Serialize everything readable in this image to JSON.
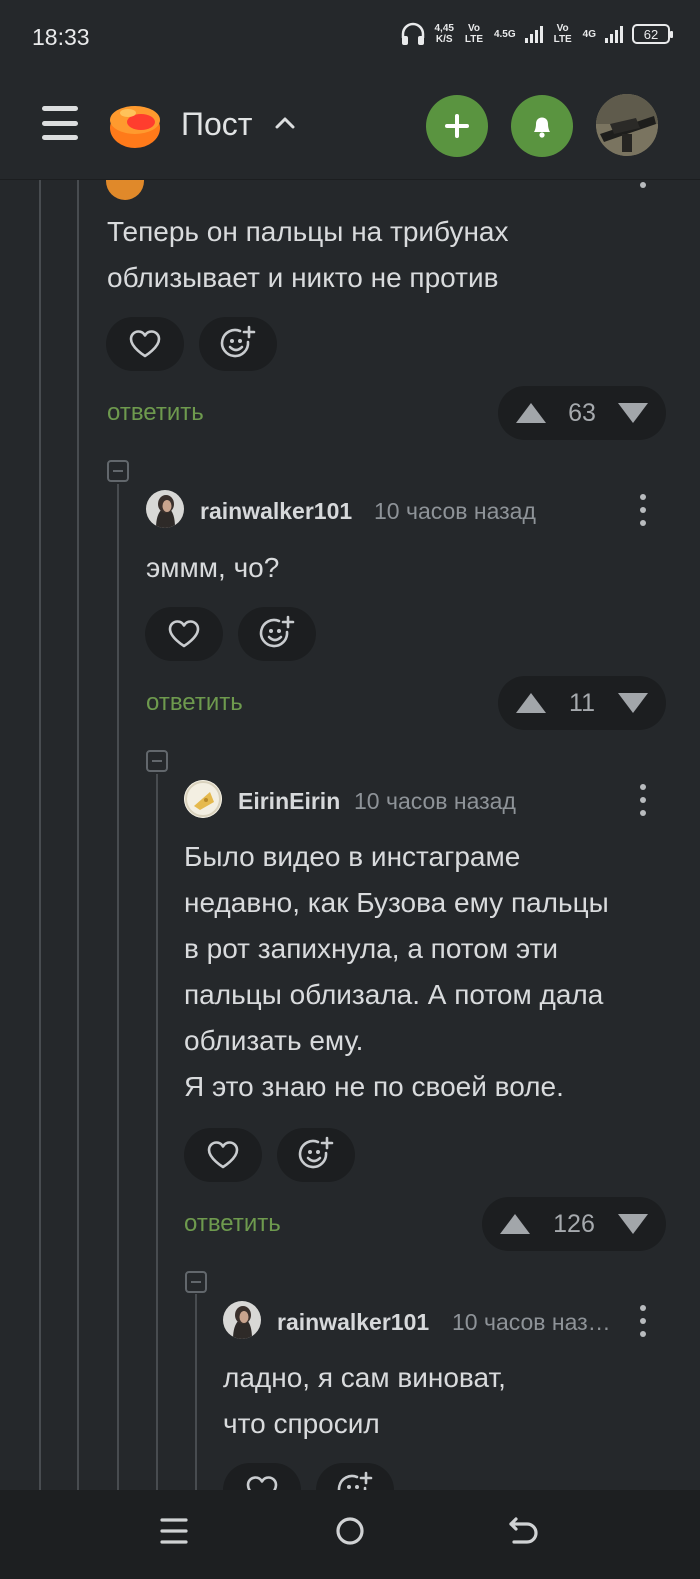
{
  "status_bar": {
    "time": "18:33",
    "net_speed": "4,45",
    "net_speed_unit": "K/S",
    "sim1": "Vo LTE",
    "sim1_tech": "4.5G",
    "sim2": "Vo LTE",
    "sim2_tech": "4G",
    "battery": "62"
  },
  "header": {
    "title": "Пост",
    "accent_color": "#5a9440"
  },
  "comments": [
    {
      "username": "",
      "time": "",
      "text_lines": [
        "Теперь он пальцы на трибунах",
        "облизывает и никто не против"
      ],
      "reply_label": "ответить",
      "rating": "63"
    },
    {
      "username": "rainwalker101",
      "time": "10 часов назад",
      "text_lines": [
        "эммм, чо?"
      ],
      "reply_label": "ответить",
      "rating": "11"
    },
    {
      "username": "EirinEirin",
      "time": "10 часов назад",
      "text_lines": [
        "Было видео в инстаграме",
        "недавно, как Бузова ему пальцы",
        "в рот запихнула, а потом эти",
        "пальцы облизала. А потом дала",
        "облизать ему.",
        "Я это знаю не по своей воле."
      ],
      "reply_label": "ответить",
      "rating": "126"
    },
    {
      "username": "rainwalker101",
      "time": "10 часов наз…",
      "text_lines": [
        "ладно, я сам виноват,",
        "что спросил"
      ]
    }
  ],
  "icons": {
    "heart": "heart-icon",
    "emoji": "emoji-add-icon",
    "upvote": "upvote-icon",
    "downvote": "downvote-icon",
    "more": "more-vertical-icon"
  }
}
